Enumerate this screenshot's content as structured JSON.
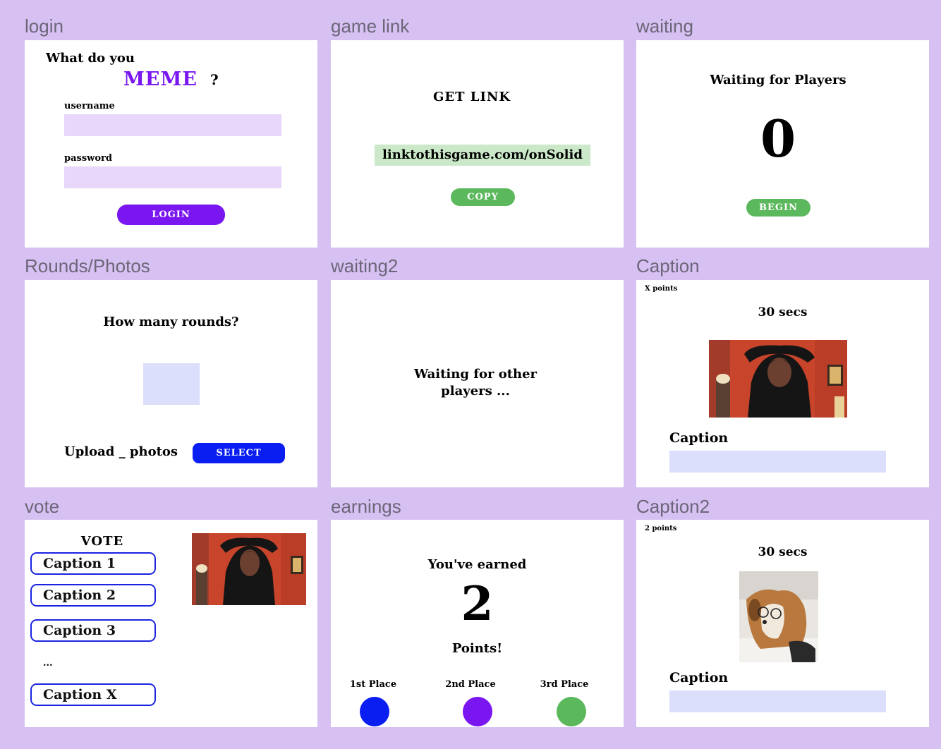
{
  "frames": {
    "login": {
      "label": "login",
      "heading": "What do you",
      "brand": "MEME",
      "question_mark": "?",
      "username_label": "username",
      "username_value": "",
      "password_label": "password",
      "password_value": "",
      "login_button": "LOGIN"
    },
    "game_link": {
      "label": "game link",
      "heading": "GET LINK",
      "link": "linktothisgame.com/onSolid",
      "copy_button": "COPY"
    },
    "waiting": {
      "label": "waiting",
      "heading": "Waiting for Players",
      "count": "0",
      "begin_button": "BEGIN"
    },
    "rounds_photos": {
      "label": "Rounds/Photos",
      "heading": "How many rounds?",
      "upload_label": "Upload _ photos",
      "select_button": "SELECT"
    },
    "waiting2": {
      "label": "waiting2",
      "line1": "Waiting for other",
      "line2": "players ..."
    },
    "caption": {
      "label": "Caption",
      "points": "X points",
      "timer": "30 secs",
      "caption_label": "Caption"
    },
    "vote": {
      "label": "vote",
      "heading": "VOTE",
      "options": [
        "Caption 1",
        "Caption 2",
        "Caption 3",
        "Caption X"
      ],
      "ellipsis": "..."
    },
    "earnings": {
      "label": "earnings",
      "heading": "You've earned",
      "amount": "2",
      "points_text": "Points!",
      "places": [
        "1st Place",
        "2nd Place",
        "3rd Place"
      ]
    },
    "caption2": {
      "label": "Caption2",
      "points": "2 points",
      "timer": "30 secs",
      "caption_label": "Caption"
    }
  },
  "colors": {
    "canvas": "#d7c1f3",
    "purple": "#7a16f0",
    "blue": "#0a1ef2",
    "green": "#5cb85c",
    "input_lavender": "#e8d7fb",
    "input_periwinkle": "#dcdffb"
  },
  "icons": {
    "photo_person": "woman-arms-raised-photo",
    "photo_dog": "dog-with-glasses-photo"
  }
}
